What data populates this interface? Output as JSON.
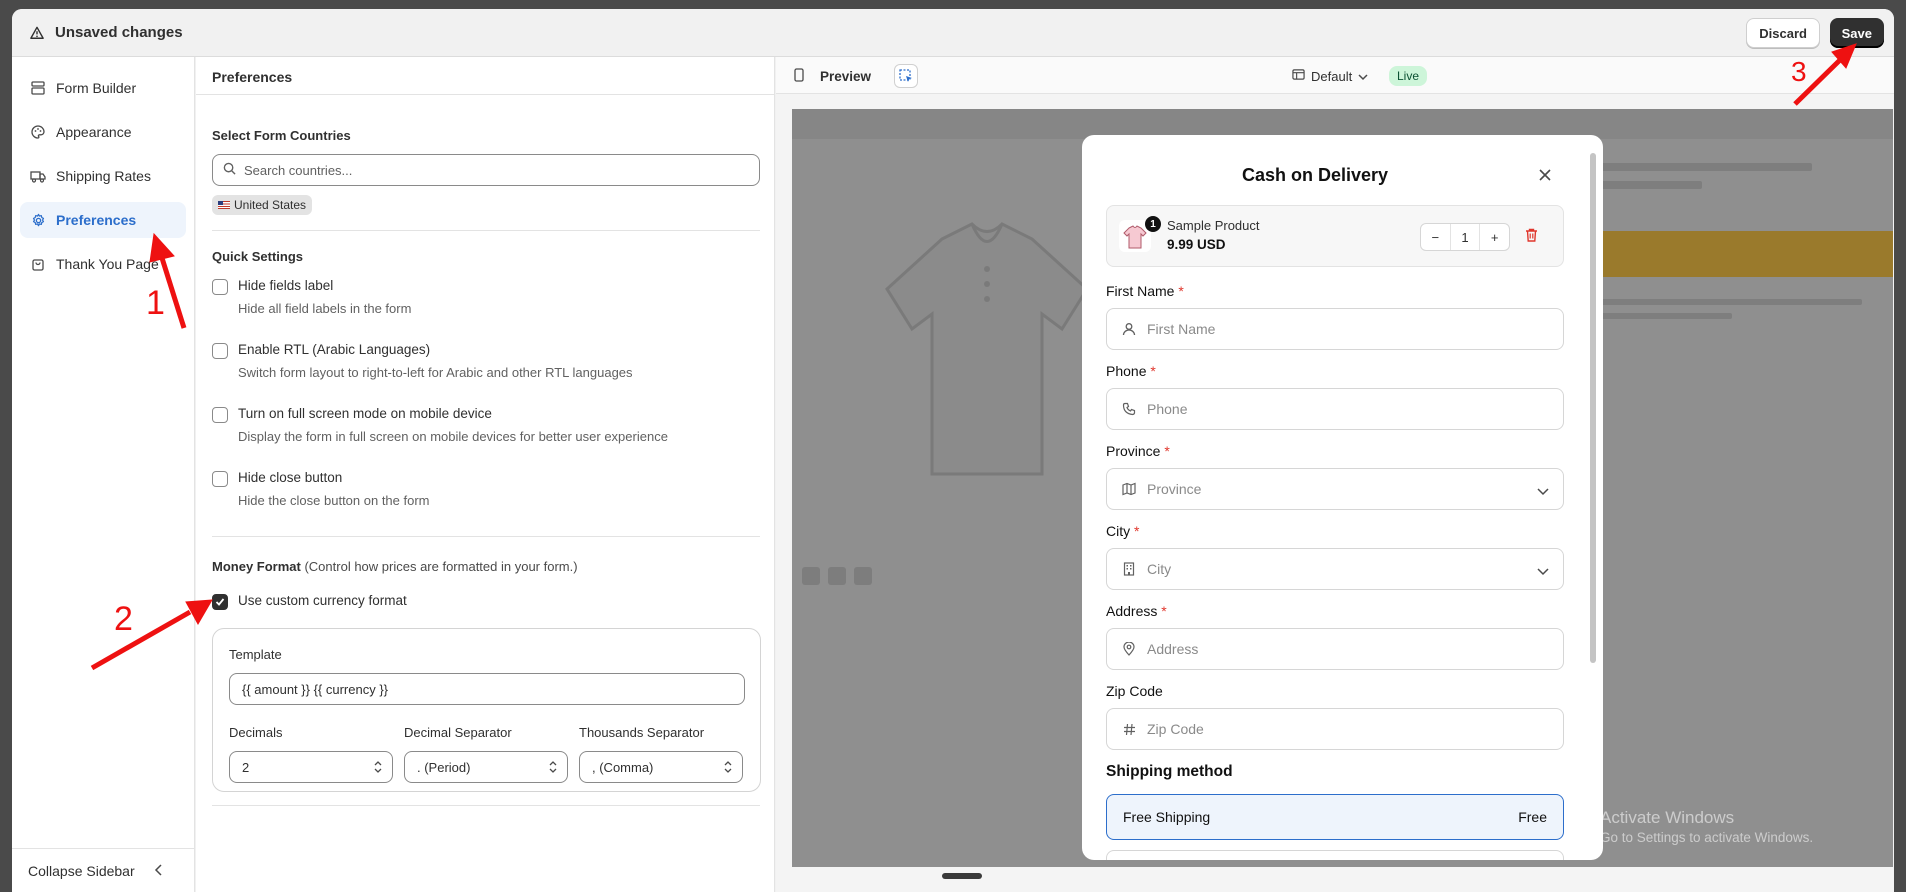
{
  "topbar": {
    "title": "Unsaved changes",
    "discard": "Discard",
    "save": "Save"
  },
  "sidebar": {
    "items": [
      {
        "label": "Form Builder",
        "icon": "layout-icon"
      },
      {
        "label": "Appearance",
        "icon": "palette-icon"
      },
      {
        "label": "Shipping Rates",
        "icon": "truck-icon"
      },
      {
        "label": "Preferences",
        "icon": "gear-icon",
        "active": true
      },
      {
        "label": "Thank You Page",
        "icon": "bag-icon"
      }
    ],
    "collapse": "Collapse Sidebar"
  },
  "panel": {
    "title": "Preferences",
    "countries_label": "Select Form Countries",
    "search_placeholder": "Search countries...",
    "country_tag": "United States",
    "quick_label": "Quick Settings",
    "options": [
      {
        "title": "Hide fields label",
        "desc": "Hide all field labels in the form",
        "checked": false
      },
      {
        "title": "Enable RTL (Arabic Languages)",
        "desc": "Switch form layout to right-to-left for Arabic and other RTL languages",
        "checked": false
      },
      {
        "title": "Turn on full screen mode on mobile device",
        "desc": "Display the form in full screen on mobile devices for better user experience",
        "checked": false
      },
      {
        "title": "Hide close button",
        "desc": "Hide the close button on the form",
        "checked": false
      }
    ],
    "money_label": "Money Format",
    "money_hint": "(Control how prices are formatted in your form.)",
    "custom_currency": "Use custom currency format",
    "custom_currency_checked": true,
    "template_label": "Template",
    "template_value": "{{ amount }} {{ currency }}",
    "decimals_label": "Decimals",
    "decimals_value": "2",
    "decimal_sep_label": "Decimal Separator",
    "decimal_sep_value": ". (Period)",
    "thousands_label": "Thousands Separator",
    "thousands_value": ", (Comma)"
  },
  "preview": {
    "title": "Preview",
    "theme": "Default",
    "status": "Live",
    "watermark_1": "Activate Windows",
    "watermark_2": "Go to Settings to activate Windows."
  },
  "modal": {
    "title": "Cash on Delivery",
    "product": {
      "name": "Sample Product",
      "price": "9.99 USD",
      "qty": "1",
      "badge": "1"
    },
    "fields": [
      {
        "label": "First Name",
        "placeholder": "First Name",
        "required": true,
        "icon": "user-icon",
        "dropdown": false
      },
      {
        "label": "Phone",
        "placeholder": "Phone",
        "required": true,
        "icon": "phone-icon",
        "dropdown": false
      },
      {
        "label": "Province",
        "placeholder": "Province",
        "required": true,
        "icon": "map-icon",
        "dropdown": true
      },
      {
        "label": "City",
        "placeholder": "City",
        "required": true,
        "icon": "building-icon",
        "dropdown": true
      },
      {
        "label": "Address",
        "placeholder": "Address",
        "required": true,
        "icon": "location-pin-icon",
        "dropdown": false
      },
      {
        "label": "Zip Code",
        "placeholder": "Zip Code",
        "required": false,
        "icon": "hash-icon",
        "dropdown": false
      }
    ],
    "required_mark": "*",
    "shipping_title": "Shipping method",
    "shipping_option": "Free Shipping",
    "shipping_price": "Free"
  },
  "annotations": {
    "a1": "1",
    "a2": "2",
    "a3": "3",
    "color": "#ee1111"
  }
}
